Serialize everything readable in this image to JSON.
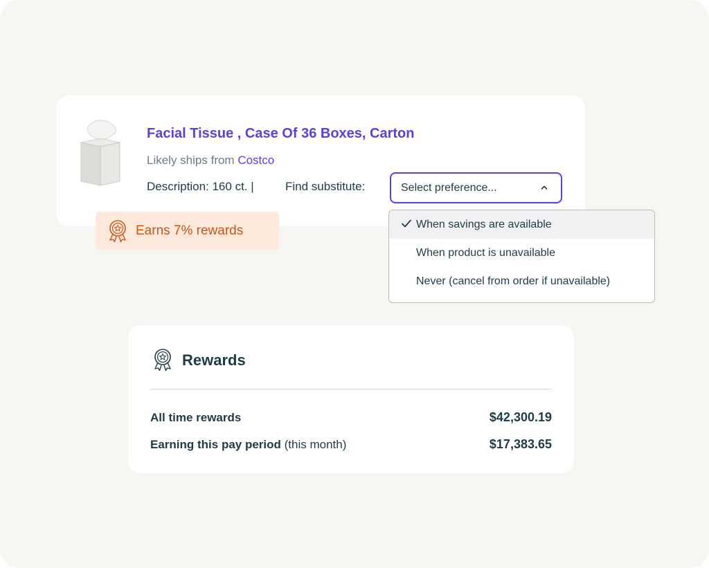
{
  "product": {
    "title": "Facial Tissue , Case Of 36 Boxes, Carton",
    "ships_prefix": "Likely ships from ",
    "vendor": "Costco",
    "description": "Description: 160 ct. |",
    "find_substitute_label": "Find substitute:",
    "select_placeholder": "Select preference...",
    "image_icon": "tissue-box"
  },
  "badge": {
    "text": "Earns 7% rewards",
    "icon": "award-ribbon-icon"
  },
  "dropdown": {
    "items": [
      {
        "label": "When savings are available",
        "selected": true
      },
      {
        "label": "When product is unavailable",
        "selected": false
      },
      {
        "label": "Never (cancel from order if unavailable)",
        "selected": false
      }
    ]
  },
  "rewards": {
    "title": "Rewards",
    "rows": [
      {
        "label": "All time rewards",
        "sub": "",
        "value": "$42,300.19"
      },
      {
        "label": "Earning this pay period",
        "sub": " (this month)",
        "value": "$17,383.65"
      }
    ]
  },
  "colors": {
    "accent": "#5b3ee6",
    "text": "#1f3b45",
    "badge_bg": "#fce9dc",
    "badge_text": "#c85618",
    "page_bg": "#f6f5f1"
  }
}
